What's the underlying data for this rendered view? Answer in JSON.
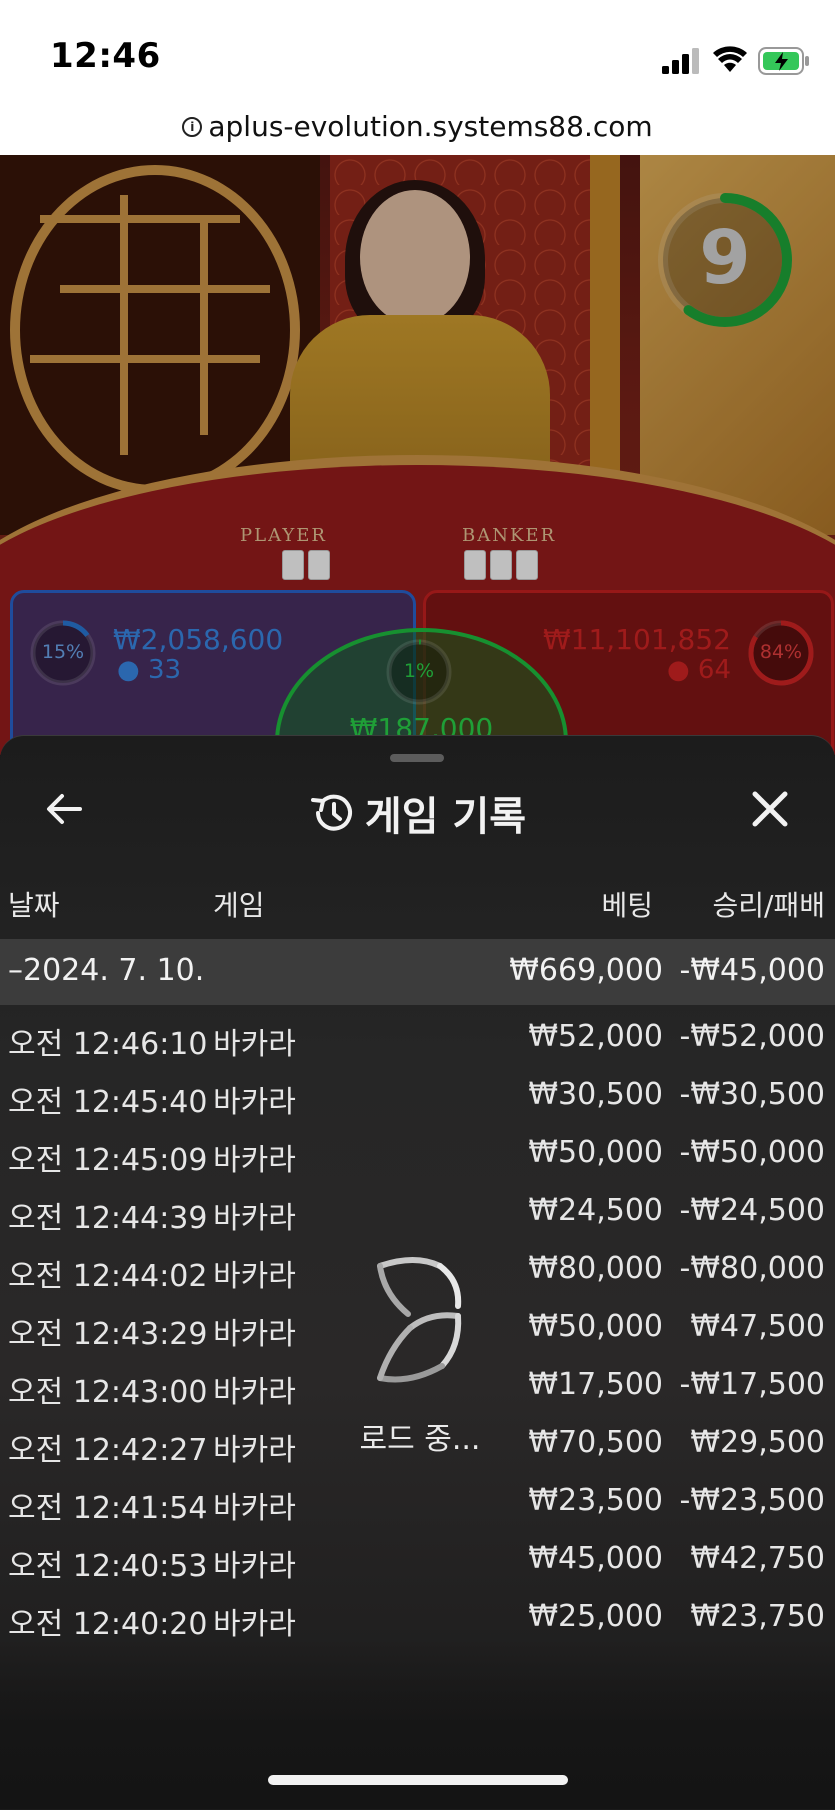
{
  "status_bar": {
    "time": "12:46"
  },
  "browser": {
    "url": "aplus-evolution.systems88.com"
  },
  "game_view": {
    "table_labels": {
      "player": "PLAYER",
      "banker": "BANKER"
    },
    "countdown": "9",
    "player_bet": {
      "percent": "15%",
      "amount": "₩2,058,600",
      "players": "33",
      "color": "#2a7ad8"
    },
    "banker_bet": {
      "percent": "84%",
      "amount": "₩11,101,852",
      "players": "64",
      "color": "#c81e1e"
    },
    "tie_bet": {
      "percent": "1%",
      "amount": "₩187,000",
      "color": "#1fc040"
    }
  },
  "history_panel": {
    "title": "게임 기록",
    "columns": {
      "date": "날짜",
      "game": "게임",
      "bet": "베팅",
      "result": "승리/패배"
    },
    "date_group": {
      "label": "–2024. 7. 10.",
      "total_bet": "₩669,000",
      "total_result": "-₩45,000"
    },
    "rows": [
      {
        "time": "오전 12:46:10",
        "game": "바카라",
        "bet": "₩52,000",
        "result": "-₩52,000"
      },
      {
        "time": "오전 12:45:40",
        "game": "바카라",
        "bet": "₩30,500",
        "result": "-₩30,500"
      },
      {
        "time": "오전 12:45:09",
        "game": "바카라",
        "bet": "₩50,000",
        "result": "-₩50,000"
      },
      {
        "time": "오전 12:44:39",
        "game": "바카라",
        "bet": "₩24,500",
        "result": "-₩24,500"
      },
      {
        "time": "오전 12:44:02",
        "game": "바카라",
        "bet": "₩80,000",
        "result": "-₩80,000"
      },
      {
        "time": "오전 12:43:29",
        "game": "바카라",
        "bet": "₩50,000",
        "result": "₩47,500"
      },
      {
        "time": "오전 12:43:00",
        "game": "바카라",
        "bet": "₩17,500",
        "result": "-₩17,500"
      },
      {
        "time": "오전 12:42:27",
        "game": "바카라",
        "bet": "₩70,500",
        "result": "₩29,500"
      },
      {
        "time": "오전 12:41:54",
        "game": "바카라",
        "bet": "₩23,500",
        "result": "-₩23,500"
      },
      {
        "time": "오전 12:40:53",
        "game": "바카라",
        "bet": "₩45,000",
        "result": "₩42,750"
      },
      {
        "time": "오전 12:40:20",
        "game": "바카라",
        "bet": "₩25,000",
        "result": "₩23,750"
      }
    ],
    "loading_text": "로드 중..."
  }
}
